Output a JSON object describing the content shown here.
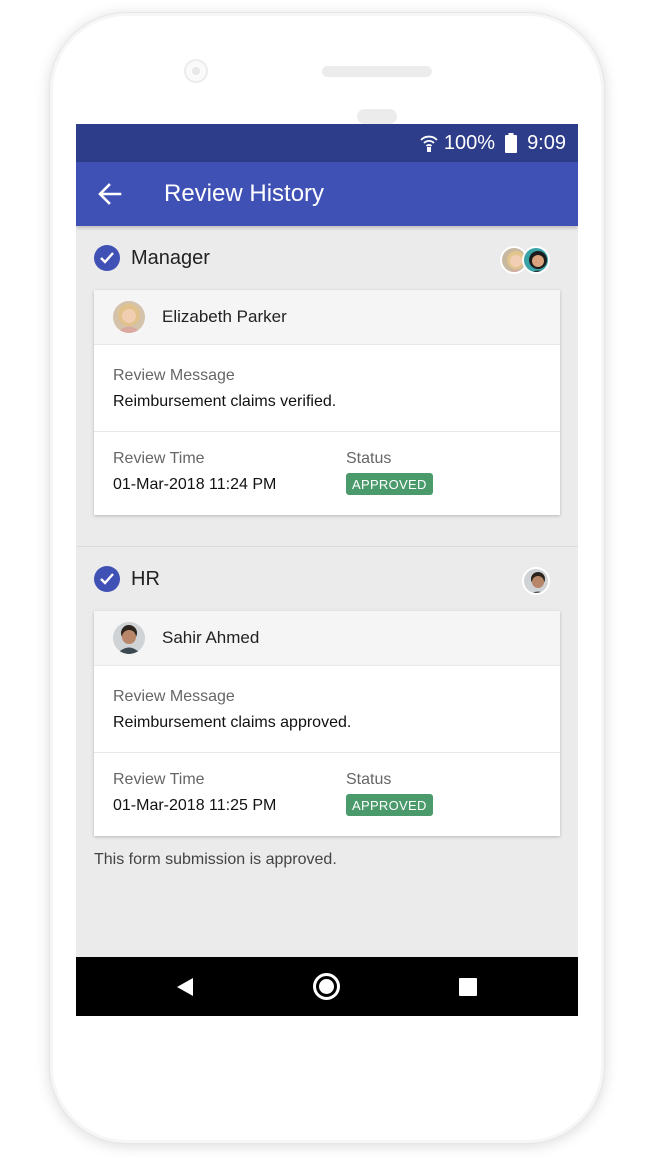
{
  "status_bar": {
    "battery_percent": "100%",
    "time": "9:09",
    "wifi_icon": "wifi-icon",
    "battery_icon": "battery-icon"
  },
  "app_bar": {
    "title": "Review History",
    "back_icon": "arrow-back-icon"
  },
  "colors": {
    "primary": "#3f51b5",
    "status_bar": "#2e3d8a",
    "approved": "#4a9a6c"
  },
  "stages": [
    {
      "title": "Manager",
      "reviewer": "Elizabeth Parker",
      "message_label": "Review Message",
      "message": "Reimbursement claims verified.",
      "time_label": "Review Time",
      "time": "01-Mar-2018 11:24 PM",
      "status_label": "Status",
      "status": "APPROVED"
    },
    {
      "title": "HR",
      "reviewer": "Sahir Ahmed",
      "message_label": "Review Message",
      "message": "Reimbursement claims approved.",
      "time_label": "Review Time",
      "time": "01-Mar-2018 11:25 PM",
      "status_label": "Status",
      "status": "APPROVED"
    }
  ],
  "footer_note": "This form submission is approved."
}
